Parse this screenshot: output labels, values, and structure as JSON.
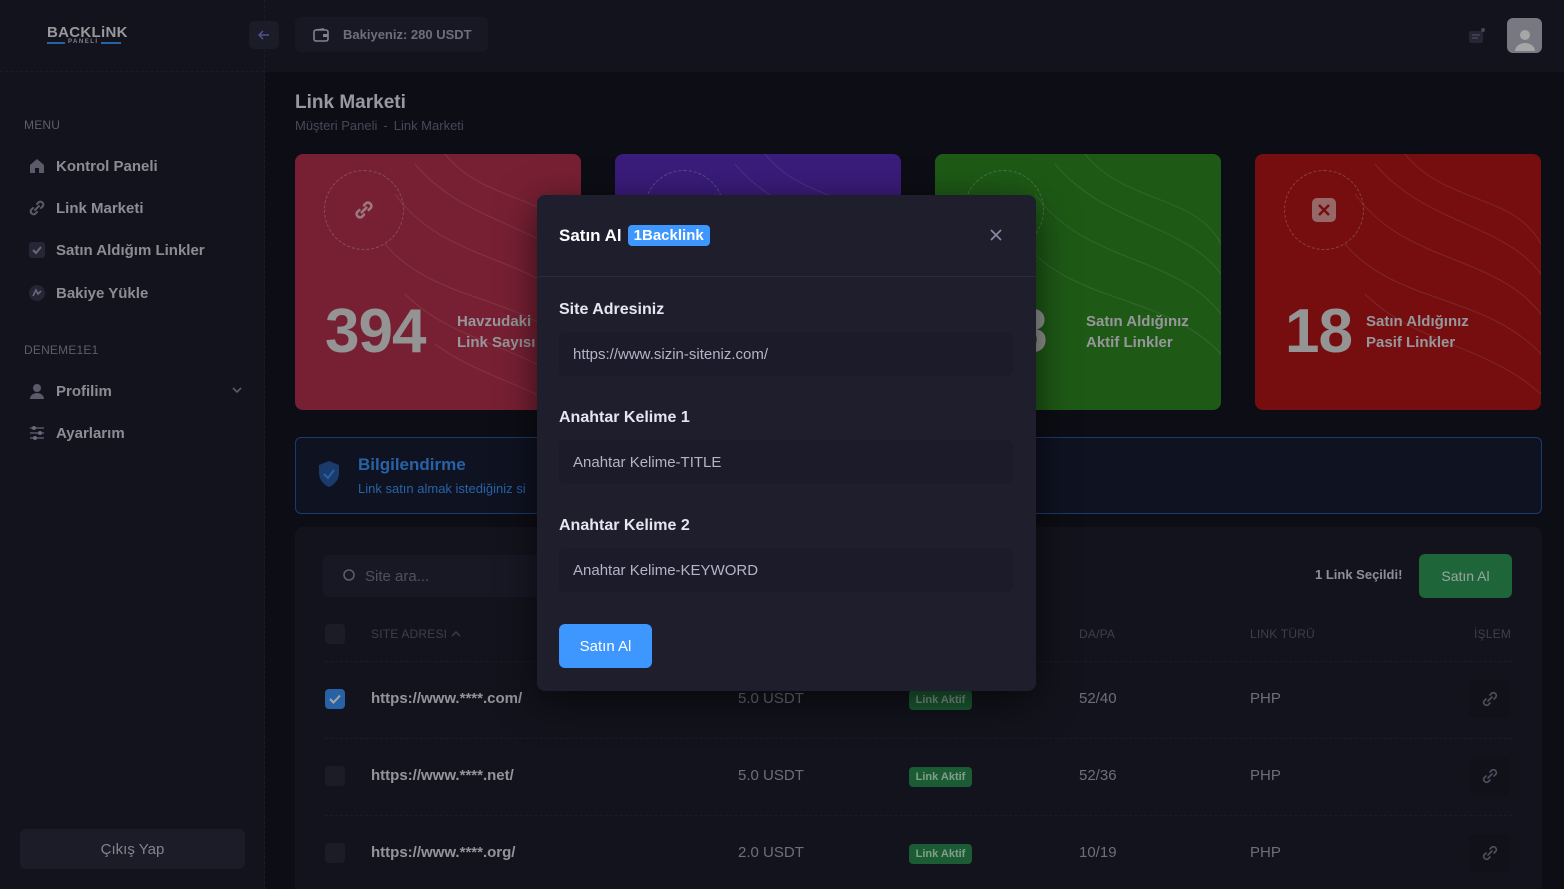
{
  "brand": {
    "name": "BACKLiNK",
    "sub": "PANELİ"
  },
  "header": {
    "balance": "Bakiyeniz: 280 USDT"
  },
  "sidebar": {
    "menu_heading": "MENU",
    "items": [
      {
        "label": "Kontrol Paneli"
      },
      {
        "label": "Link Marketi"
      },
      {
        "label": "Satın Aldığım Linkler"
      },
      {
        "label": "Bakiye Yükle"
      }
    ],
    "user_heading": "DENEME1E1",
    "user_items": [
      {
        "label": "Profilim"
      },
      {
        "label": "Ayarlarım"
      }
    ],
    "logout": "Çıkış Yap"
  },
  "page": {
    "title": "Link Marketi",
    "breadcrumb": [
      "Müşteri Paneli",
      "-",
      "Link Marketi"
    ]
  },
  "stats": [
    {
      "value": "394",
      "label_line1": "Havzudaki",
      "label_line2": "Link Sayısı",
      "color": "#b8324f"
    },
    {
      "value": "",
      "label_line1": "",
      "label_line2": "",
      "color": "#5a2bbd"
    },
    {
      "value": "8",
      "label_line1": "Satın Aldığınız",
      "label_line2": "Aktif Linkler",
      "color": "#2f8a22"
    },
    {
      "value": "18",
      "label_line1": "Satın Aldığınız",
      "label_line2": "Pasif Linkler",
      "color": "#b51619"
    }
  ],
  "info": {
    "title": "Bilgilendirme",
    "text": "Link satın almak istediğiniz si"
  },
  "table": {
    "search_placeholder": "Site ara...",
    "selected_count": "1  Link Seçildi!",
    "buy_label": "Satın Al",
    "headers": {
      "site": "SITE ADRESI",
      "dapa": "DA/PA",
      "link_type": "LINK TÜRÜ",
      "action": "İŞLEM"
    },
    "rows": [
      {
        "url": "https://www.****.com/",
        "price": "5.0 USDT",
        "status": "Link Aktif",
        "dapa": "52/40",
        "type": "PHP",
        "checked": true
      },
      {
        "url": "https://www.****.net/",
        "price": "5.0 USDT",
        "status": "Link Aktif",
        "dapa": "52/36",
        "type": "PHP",
        "checked": false
      },
      {
        "url": "https://www.****.org/",
        "price": "2.0 USDT",
        "status": "Link Aktif",
        "dapa": "10/19",
        "type": "PHP",
        "checked": false
      }
    ]
  },
  "modal": {
    "title": "Satın Al",
    "badge": "1Backlink",
    "fields": [
      {
        "label": "Site Adresiniz",
        "placeholder": "https://www.sizin-siteniz.com/"
      },
      {
        "label": "Anahtar Kelime 1",
        "placeholder": "Anahtar Kelime-TITLE"
      },
      {
        "label": "Anahtar Kelime 2",
        "placeholder": "Anahtar Kelime-KEYWORD"
      }
    ],
    "submit": "Satın Al"
  }
}
